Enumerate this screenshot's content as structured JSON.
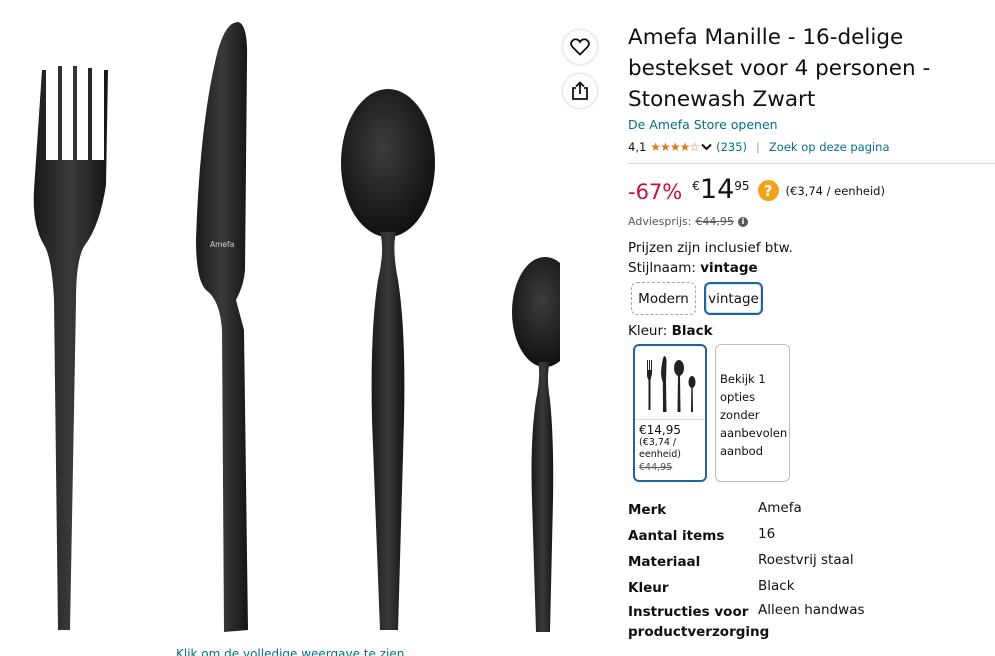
{
  "product": {
    "title": "Amefa Manille - 16-delige bestekset voor 4 personen - Stonewash Zwart",
    "store_link": "De Amefa Store openen",
    "rating_value": "4,1",
    "rating_stars": "★★★★☆",
    "rating_count": "(235)",
    "search_link": "Zoek op deze pagina",
    "knife_brand": "Amefa"
  },
  "price": {
    "discount": "-67%",
    "currency": "€",
    "whole": "14",
    "fraction": "95",
    "help_icon": "?",
    "per_unit": "(€3,74 / eenheid)",
    "list_label": "Adviesprijs:",
    "list_price": "€44,95",
    "info_icon": "i",
    "vat_note": "Prijzen zijn inclusief btw."
  },
  "style": {
    "label": "Stijlnaam:",
    "selected": "vintage",
    "options": [
      "Modern",
      "vintage"
    ]
  },
  "color": {
    "label": "Kleur:",
    "selected": "Black",
    "swatch_price": "€14,95",
    "swatch_unit": "(€3,74 / eenheid)",
    "swatch_old_price": "€44,95",
    "other_option_text": "Bekijk 1 opties zonder aanbevolen aanbod"
  },
  "specs": [
    {
      "key": "Merk",
      "value": "Amefa"
    },
    {
      "key": "Aantal items",
      "value": "16"
    },
    {
      "key": "Materiaal",
      "value": "Roestvrij staal"
    },
    {
      "key": "Kleur",
      "value": "Black"
    },
    {
      "key": "Instructies voor productverzorging",
      "value": "Alleen handwas"
    }
  ],
  "image": {
    "caption": "Klik om de volledige weergave te zien"
  },
  "icons": {
    "wishlist": "heart-icon",
    "share": "share-icon"
  },
  "colors": {
    "link": "#007185",
    "discount": "#cc0c39",
    "stars": "#de7921",
    "selected_border": "#2162a1"
  }
}
